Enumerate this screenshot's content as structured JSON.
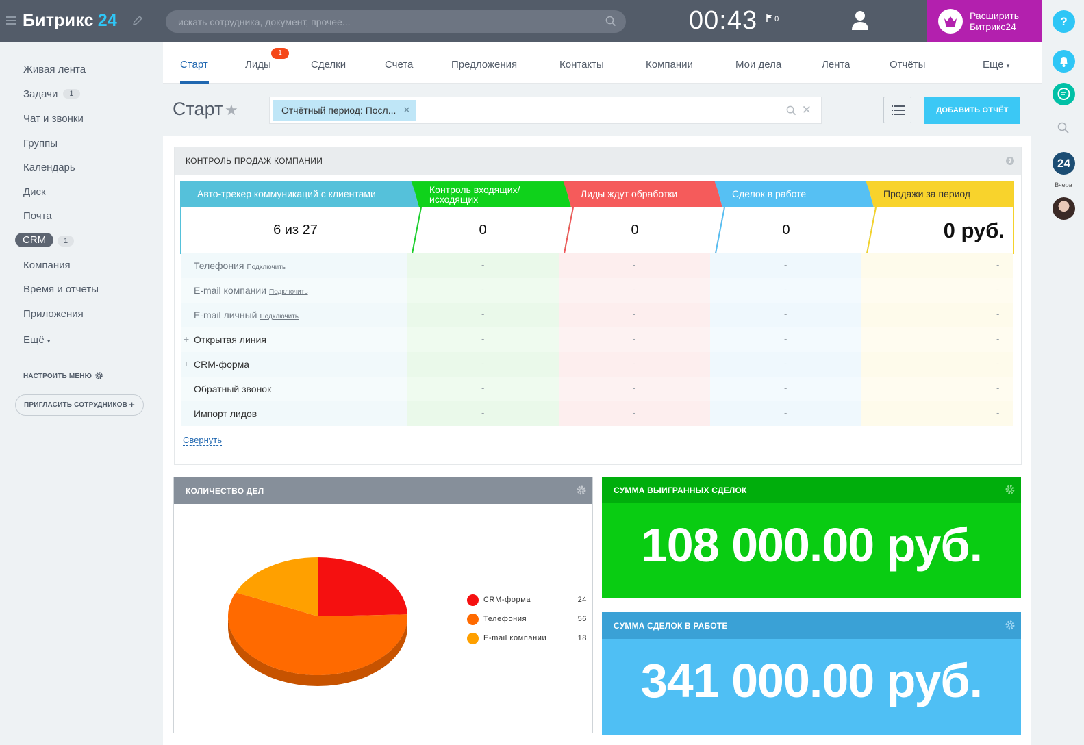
{
  "header": {
    "logo_text": "Битрикс",
    "logo_num": "24",
    "search_placeholder": "искать сотрудника, документ, прочее...",
    "time": "00:43",
    "flag_count": "0",
    "upgrade_line1": "Расширить",
    "upgrade_line2": "Битрикс24"
  },
  "rail": {
    "help": "?",
    "b24": "24",
    "yesterday": "Вчера"
  },
  "sidebar": {
    "items": [
      {
        "label": "Живая лента"
      },
      {
        "label": "Задачи",
        "count": "1"
      },
      {
        "label": "Чат и звонки"
      },
      {
        "label": "Группы"
      },
      {
        "label": "Календарь"
      },
      {
        "label": "Диск"
      },
      {
        "label": "Почта"
      },
      {
        "label": "CRM",
        "count": "1"
      },
      {
        "label": "Компания"
      },
      {
        "label": "Время и отчеты"
      },
      {
        "label": "Приложения"
      },
      {
        "label": "Ещё"
      }
    ],
    "setup_menu": "НАСТРОИТЬ МЕНЮ",
    "invite": "ПРИГЛАСИТЬ СОТРУДНИКОВ"
  },
  "tabs": {
    "items": [
      "Старт",
      "Лиды",
      "Сделки",
      "Счета",
      "Предложения",
      "Контакты",
      "Компании",
      "Мои дела",
      "Лента",
      "Отчёты",
      "Еще"
    ],
    "leads_badge": "1"
  },
  "toolbar": {
    "title": "Старт",
    "filter_chip": "Отчётный период: Посл...",
    "add_report": "ДОБАВИТЬ ОТЧЁТ"
  },
  "sales": {
    "title": "КОНТРОЛЬ ПРОДАЖ КОМПАНИИ",
    "columns": [
      {
        "title": "Авто-трекер коммуникаций с клиентами",
        "value": "6 из 27"
      },
      {
        "title": "Контроль входящих/ исходящих",
        "value": "0"
      },
      {
        "title": "Лиды ждут обработки",
        "value": "0"
      },
      {
        "title": "Сделок в работе",
        "value": "0"
      },
      {
        "title": "Продажи за период",
        "value": "0 руб."
      }
    ],
    "rows": [
      {
        "label": "Телефония",
        "connect": "Подключить"
      },
      {
        "label": "E-mail компании",
        "connect": "Подключить"
      },
      {
        "label": "E-mail личный",
        "connect": "Подключить"
      },
      {
        "label": "Открытая линия"
      },
      {
        "label": "CRM-форма"
      },
      {
        "label": "Обратный звонок"
      },
      {
        "label": "Импорт лидов"
      }
    ],
    "dash": "-",
    "collapse": "Свернуть"
  },
  "widgets": {
    "count_title": "КОЛИЧЕСТВО ДЕЛ",
    "won_title": "СУММА ВЫИГРАННЫХ СДЕЛОК",
    "won_value": "108 000.00 руб.",
    "work_title": "СУММА СДЕЛОК В РАБОТЕ",
    "work_value": "341 000.00 руб."
  },
  "chart_data": {
    "type": "pie",
    "slices": [
      {
        "label": "CRM-форма",
        "value": 24,
        "color": "#f51010"
      },
      {
        "label": "Телефония",
        "value": 56,
        "color": "#ff6a00"
      },
      {
        "label": "E-mail компании",
        "value": 18,
        "color": "#ffa000"
      }
    ]
  }
}
